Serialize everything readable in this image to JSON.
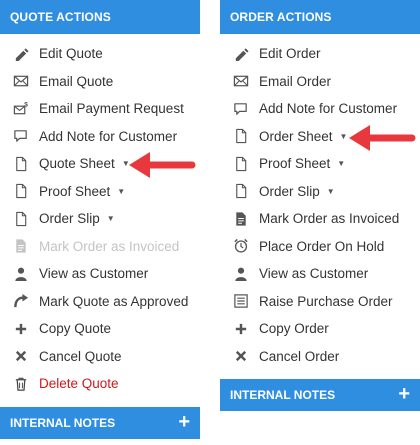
{
  "quote_panel": {
    "title": "QUOTE ACTIONS",
    "items": [
      {
        "label": "Edit Quote",
        "icon": "pencil-icon"
      },
      {
        "label": "Email Quote",
        "icon": "envelope-icon"
      },
      {
        "label": "Email Payment Request",
        "icon": "envelope-dollar-icon"
      },
      {
        "label": "Add Note for Customer",
        "icon": "speech-bubble-icon"
      },
      {
        "label": "Quote Sheet",
        "icon": "document-icon",
        "caret": "▼"
      },
      {
        "label": "Proof Sheet",
        "icon": "document-icon",
        "caret": "▼"
      },
      {
        "label": "Order Slip",
        "icon": "document-icon",
        "caret": "▼"
      },
      {
        "label": "Mark Order as Invoiced",
        "icon": "invoice-document-icon",
        "disabled": true
      },
      {
        "label": "View as Customer",
        "icon": "user-icon"
      },
      {
        "label": "Mark Quote as Approved",
        "icon": "curved-arrow-icon"
      },
      {
        "label": "Copy Quote",
        "icon": "plus-icon"
      },
      {
        "label": "Cancel Quote",
        "icon": "x-icon"
      },
      {
        "label": "Delete Quote",
        "icon": "trash-icon",
        "danger": true
      }
    ],
    "footer_title": "INTERNAL NOTES",
    "footer_plus": "+"
  },
  "order_panel": {
    "title": "ORDER ACTIONS",
    "items": [
      {
        "label": "Edit Order",
        "icon": "pencil-icon"
      },
      {
        "label": "Email Order",
        "icon": "envelope-icon"
      },
      {
        "label": "Add Note for Customer",
        "icon": "speech-bubble-icon"
      },
      {
        "label": "Order Sheet",
        "icon": "document-icon",
        "caret": "▼"
      },
      {
        "label": "Proof Sheet",
        "icon": "document-icon",
        "caret": "▼"
      },
      {
        "label": "Order Slip",
        "icon": "document-icon",
        "caret": "▼"
      },
      {
        "label": "Mark Order as Invoiced",
        "icon": "invoice-document-icon"
      },
      {
        "label": "Place Order On Hold",
        "icon": "alarm-clock-icon"
      },
      {
        "label": "View as Customer",
        "icon": "user-icon"
      },
      {
        "label": "Raise Purchase Order",
        "icon": "list-document-icon"
      },
      {
        "label": "Copy Order",
        "icon": "plus-icon"
      },
      {
        "label": "Cancel Order",
        "icon": "x-icon"
      }
    ],
    "footer_title": "INTERNAL NOTES",
    "footer_plus": "+"
  },
  "colors": {
    "header": "#2f8ee0",
    "danger": "#d0191b",
    "arrow": "#e8383d",
    "disabled": "#c4c4c4"
  }
}
